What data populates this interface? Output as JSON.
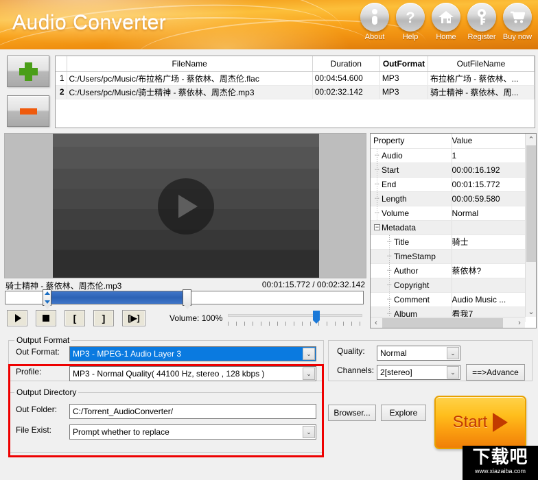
{
  "header": {
    "title": "Audio Converter",
    "buttons": [
      {
        "label": "About",
        "icon": "info-icon"
      },
      {
        "label": "Help",
        "icon": "question-icon"
      },
      {
        "label": "Home",
        "icon": "home-icon"
      },
      {
        "label": "Register",
        "icon": "key-icon"
      },
      {
        "label": "Buy now",
        "icon": "cart-icon"
      }
    ],
    "accent": "#f5a623"
  },
  "sidebuttons": {
    "add": "add-file-button",
    "remove": "remove-file-button"
  },
  "filelist": {
    "columns": [
      "",
      "FileName",
      "Duration",
      "OutFormat",
      "OutFileName"
    ],
    "bold_column": "OutFormat",
    "rows": [
      {
        "index": "1",
        "filename": "C:/Users/pc/Music/布拉格广场 - 蔡依林、周杰伦.flac",
        "duration": "00:04:54.600",
        "outformat": "MP3",
        "outfilename": "布拉格广场 - 蔡依林、..."
      },
      {
        "index": "2",
        "filename": "C:/Users/pc/Music/骑士精神 - 蔡依林、周杰伦.mp3",
        "duration": "00:02:32.142",
        "outformat": "MP3",
        "outfilename": "骑士精神 - 蔡依林、周..."
      }
    ]
  },
  "player": {
    "nowplaying": "骑士精神 - 蔡依林、周杰伦.mp3",
    "time": "00:01:15.772 / 00:02:32.142",
    "volume_label": "Volume: 100%",
    "volume_percent": 100,
    "transport": [
      {
        "name": "play-button",
        "glyph": "play"
      },
      {
        "name": "stop-button",
        "glyph": "stop"
      },
      {
        "name": "set-in-button",
        "glyph": "["
      },
      {
        "name": "set-out-button",
        "glyph": "]"
      },
      {
        "name": "preview-selection-button",
        "glyph": "[▶]"
      }
    ]
  },
  "properties": {
    "col_property": "Property",
    "col_value": "Value",
    "rows": [
      {
        "name": "Audio",
        "value": "1",
        "level": 1,
        "shade": false,
        "group": false
      },
      {
        "name": "Start",
        "value": "00:00:16.192",
        "level": 1,
        "shade": true,
        "group": false
      },
      {
        "name": "End",
        "value": "00:01:15.772",
        "level": 1,
        "shade": false,
        "group": false
      },
      {
        "name": "Length",
        "value": "00:00:59.580",
        "level": 1,
        "shade": true,
        "group": false
      },
      {
        "name": "Volume",
        "value": "Normal",
        "level": 1,
        "shade": false,
        "group": false
      },
      {
        "name": "Metadata",
        "value": "",
        "level": 1,
        "shade": true,
        "group": true
      },
      {
        "name": "Title",
        "value": "骑士",
        "level": 2,
        "shade": false,
        "group": false
      },
      {
        "name": "TimeStamp",
        "value": "",
        "level": 2,
        "shade": true,
        "group": false
      },
      {
        "name": "Author",
        "value": "蔡依林?",
        "level": 2,
        "shade": false,
        "group": false
      },
      {
        "name": "Copyright",
        "value": "",
        "level": 2,
        "shade": true,
        "group": false
      },
      {
        "name": "Comment",
        "value": "Audio Music ...",
        "level": 2,
        "shade": false,
        "group": false
      },
      {
        "name": "Album",
        "value": "看我7",
        "level": 2,
        "shade": true,
        "group": false
      }
    ]
  },
  "output_format": {
    "group_title": "Output Format",
    "out_format_label": "Out Format:",
    "out_format_value": "MP3 - MPEG-1 Audio Layer 3",
    "profile_label": "Profile:",
    "profile_value": "MP3 - Normal Quality( 44100 Hz, stereo , 128 kbps )"
  },
  "right_panel": {
    "quality_label": "Quality:",
    "quality_value": "Normal",
    "channels_label": "Channels:",
    "channels_value": "2[stereo]",
    "advance_label": "==>Advance"
  },
  "output_directory": {
    "group_title": "Output Directory",
    "out_folder_label": "Out Folder:",
    "out_folder_value": "C:/Torrent_AudioConverter/",
    "file_exist_label": "File Exist:",
    "file_exist_value": "Prompt whether to replace",
    "browser_label": "Browser...",
    "explore_label": "Explore"
  },
  "start": {
    "label": "Start"
  },
  "watermark": {
    "text": "下载吧",
    "url": "www.xiazaiba.com"
  },
  "highlight": {
    "color": "#ee0000"
  }
}
